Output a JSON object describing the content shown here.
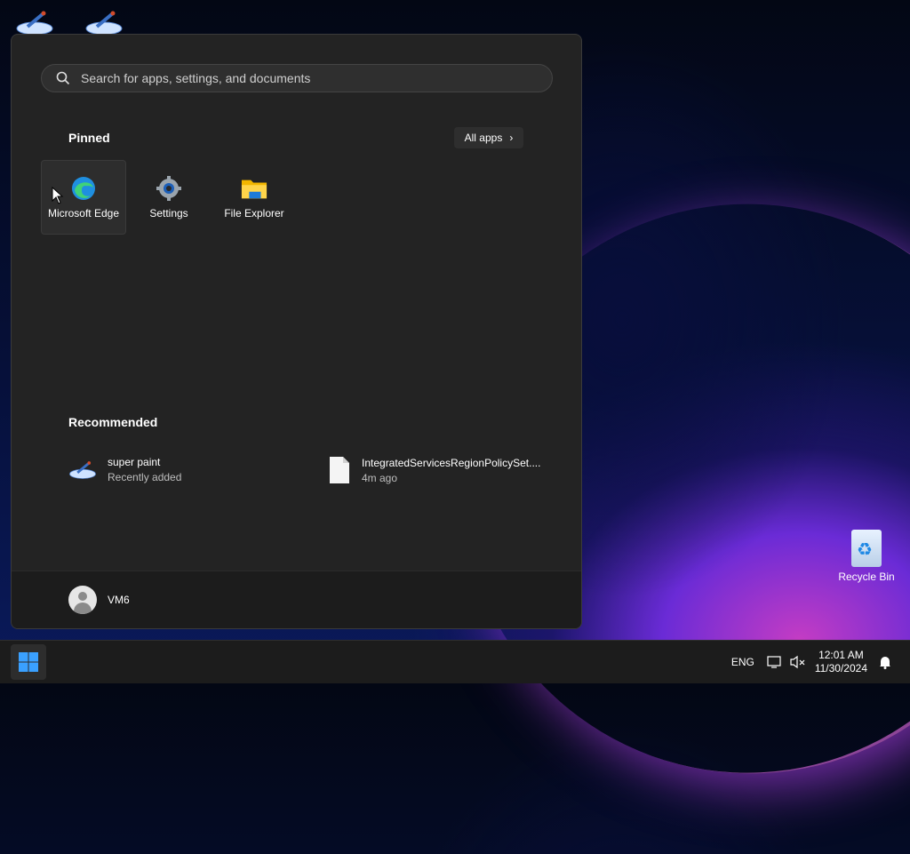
{
  "desktop": {
    "recycle_bin_label": "Recycle Bin"
  },
  "start_menu": {
    "search_placeholder": "Search for apps, settings, and documents",
    "pinned_title": "Pinned",
    "all_apps_label": "All apps",
    "pinned_apps": [
      {
        "label": "Microsoft Edge",
        "icon": "edge-icon"
      },
      {
        "label": "Settings",
        "icon": "settings-gear-icon"
      },
      {
        "label": "File Explorer",
        "icon": "folder-icon"
      }
    ],
    "recommended_title": "Recommended",
    "recommended": [
      {
        "title": "super paint",
        "subtitle": "Recently added",
        "icon": "paint-icon"
      },
      {
        "title": "IntegratedServicesRegionPolicySet....",
        "subtitle": "4m ago",
        "icon": "file-icon"
      }
    ],
    "user_name": "VM6"
  },
  "taskbar": {
    "language": "ENG",
    "time": "12:01 AM",
    "date": "11/30/2024"
  }
}
